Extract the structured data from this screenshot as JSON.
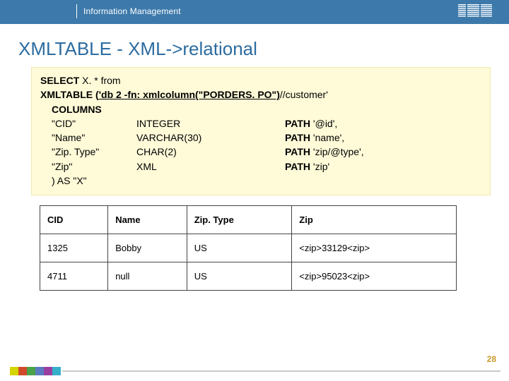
{
  "header": {
    "title": "Information Management",
    "logo_name": "ibm-logo"
  },
  "slide_title": "XMLTABLE -  XML->relational",
  "code": {
    "l1_a": "SELECT",
    "l1_b": " X. * from",
    "l2_a": "XMLTABLE (",
    "l2_b": "'db 2 -fn: xmlcolumn(\"PORDERS. PO\")",
    "l2_c": "//customer'",
    "col_kw": "COLUMNS",
    "r1_a": "\"CID\"",
    "r1_b": " INTEGER",
    "r1_c_kw": "PATH",
    "r1_c": " '@id',",
    "r2_a": "\"Name\"",
    "r2_b": "VARCHAR(30)",
    "r2_c_kw": "PATH",
    "r2_c": " 'name',",
    "r3_a": "\"Zip. Type\"",
    "r3_b": "CHAR(2)",
    "r3_c_kw": "PATH",
    "r3_c": " 'zip/@type',",
    "r4_a": "\"Zip\"",
    "r4_b": "XML",
    "r4_c_kw": "PATH",
    "r4_c": " 'zip'",
    "close": ") AS \"X\""
  },
  "table": {
    "head": {
      "c1": "CID",
      "c2": "Name",
      "c3": "Zip. Type",
      "c4": "Zip"
    },
    "rows": [
      {
        "c1": "1325",
        "c2": "Bobby",
        "c3": "US",
        "c4": "<zip>33129<zip>"
      },
      {
        "c1": "4711",
        "c2": "null",
        "c3": "US",
        "c4": "<zip>95023<zip>"
      }
    ]
  },
  "slide_number": "28",
  "footer_colors": [
    "#d4d400",
    "#d04a2a",
    "#4aa24a",
    "#5a7bc0",
    "#9a3fa0",
    "#36b0c9"
  ]
}
